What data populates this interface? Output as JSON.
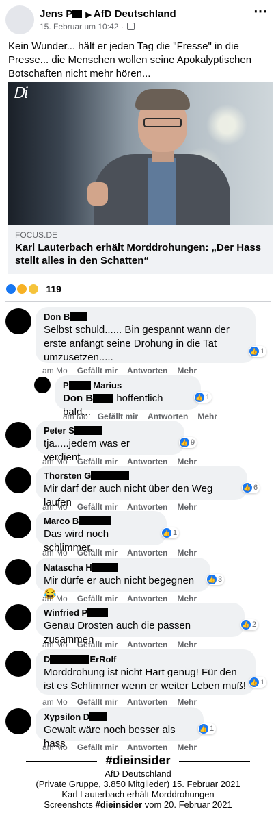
{
  "post": {
    "author": "Jens P",
    "group": "AfD Deutschland",
    "date": "15. Februar um 10:42 ·",
    "text": "Kein Wunder... hält er jeden Tag die \"Fresse\" in die Presse... die Menschen wollen seine Apokalyptischen Botschaften nicht mehr hören...",
    "more_icon": "⋯"
  },
  "link": {
    "logo": "Ꭰi",
    "domain": "FOCUS.DE",
    "title": "Karl Lauterbach erhält Morddrohungen: „Der Hass stellt alles in den Schatten“"
  },
  "reactions": {
    "count": "119"
  },
  "actions": {
    "time": "am Mo",
    "like": "Gefällt mir",
    "reply": "Antworten",
    "more": "Mehr"
  },
  "comments": [
    {
      "author": "Don B",
      "text": "Selbst schuld...... Bin gespannt wann der erste anfängt seine Drohung in die Tat umzusetzen.....",
      "likes": "1"
    },
    {
      "author": "Marius",
      "author_prefix": "P",
      "mention": "Don B",
      "text": "hoffentlich bald...",
      "likes": "1"
    },
    {
      "author": "Peter S",
      "text": "tja.....jedem was er verdient....",
      "likes": "9"
    },
    {
      "author": "Thorsten G",
      "text": "Mir darf der auch nicht über den Weg laufen",
      "likes": "6"
    },
    {
      "author": "Marco B",
      "text": "Das wird noch schlimmer.",
      "likes": "1"
    },
    {
      "author": "Natascha H",
      "text": "Mir dürfe er auch nicht begegnen 😂",
      "likes": "3"
    },
    {
      "author": "Winfried P",
      "text": "Genau Drosten auch die passen zusammen",
      "likes": "2"
    },
    {
      "author": "D",
      "author_suffix": "ErRolf",
      "text": "Morddrohung ist nicht Hart genug! Für den ist es Schlimmer wenn er weiter Leben muß!",
      "likes": "1"
    },
    {
      "author": "Xypsilon D",
      "text": "Gewalt wäre noch besser als hass",
      "likes": "1"
    }
  ],
  "footer": {
    "brand": "#dieinsider",
    "line1": "AfD Deutschland",
    "line2": "(Private Gruppe, 3.850 Mitglieder) 15. Februar 2021",
    "line3": "Karl Lauterbach erhält Morddrohungen",
    "line4_pre": "Screenshcts",
    "line4_brand": "#dieinsider",
    "line4_post": "vom 20. Februar 2021"
  },
  "colors": {
    "accent": "#1877f2",
    "bubble": "#eff1f3",
    "muted": "#65676b"
  }
}
